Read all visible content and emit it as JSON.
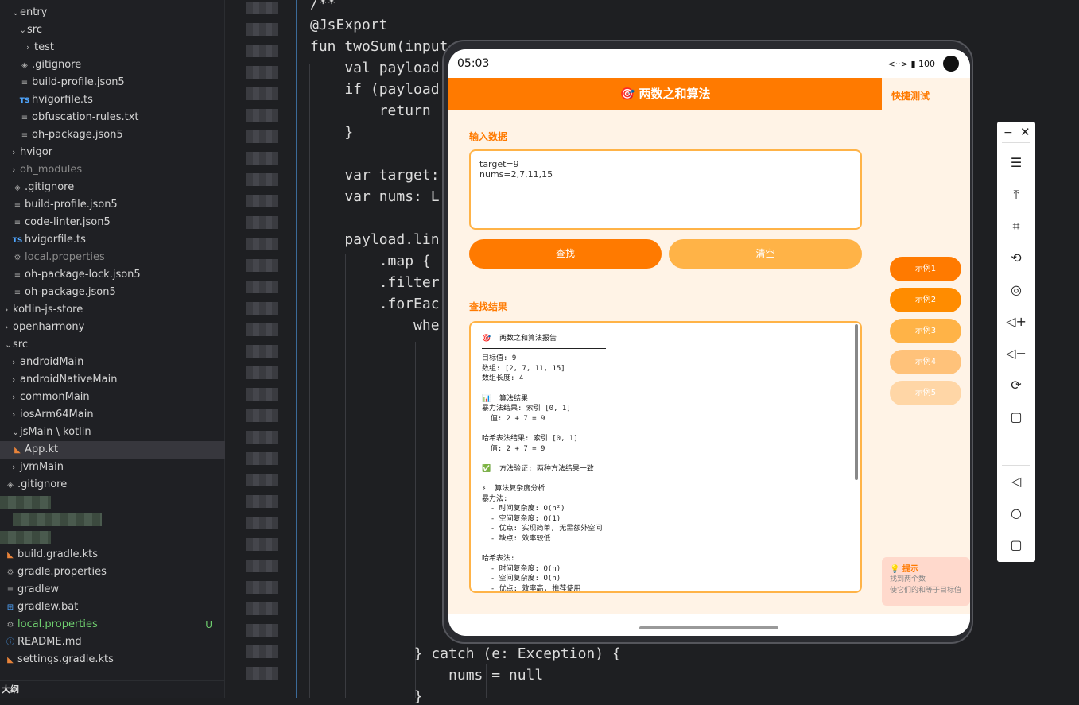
{
  "file_tree": [
    {
      "label": "entry",
      "depth": 1,
      "chevron": "v",
      "icon": ""
    },
    {
      "label": "src",
      "depth": 2,
      "chevron": "v",
      "icon": ""
    },
    {
      "label": "test",
      "depth": 3,
      "chevron": ">",
      "icon": ""
    },
    {
      "label": ".gitignore",
      "depth": 2,
      "chevron": "",
      "icon": "diamond"
    },
    {
      "label": "build-profile.json5",
      "depth": 2,
      "chevron": "",
      "icon": "lines"
    },
    {
      "label": "hvigorfile.ts",
      "depth": 2,
      "chevron": "",
      "icon": "ts"
    },
    {
      "label": "obfuscation-rules.txt",
      "depth": 2,
      "chevron": "",
      "icon": "lines"
    },
    {
      "label": "oh-package.json5",
      "depth": 2,
      "chevron": "",
      "icon": "lines"
    },
    {
      "label": "hvigor",
      "depth": 1,
      "chevron": ">",
      "icon": ""
    },
    {
      "label": "oh_modules",
      "depth": 1,
      "chevron": ">",
      "icon": "",
      "dim": true
    },
    {
      "label": ".gitignore",
      "depth": 1,
      "chevron": "",
      "icon": "diamond"
    },
    {
      "label": "build-profile.json5",
      "depth": 1,
      "chevron": "",
      "icon": "lines"
    },
    {
      "label": "code-linter.json5",
      "depth": 1,
      "chevron": "",
      "icon": "lines"
    },
    {
      "label": "hvigorfile.ts",
      "depth": 1,
      "chevron": "",
      "icon": "ts"
    },
    {
      "label": "local.properties",
      "depth": 1,
      "chevron": "",
      "icon": "gear",
      "dim": true
    },
    {
      "label": "oh-package-lock.json5",
      "depth": 1,
      "chevron": "",
      "icon": "lines"
    },
    {
      "label": "oh-package.json5",
      "depth": 1,
      "chevron": "",
      "icon": "lines"
    },
    {
      "label": "kotlin-js-store",
      "depth": 0,
      "chevron": ">",
      "icon": ""
    },
    {
      "label": "openharmony",
      "depth": 0,
      "chevron": ">",
      "icon": ""
    },
    {
      "label": "src",
      "depth": 0,
      "chevron": "v",
      "icon": ""
    },
    {
      "label": "androidMain",
      "depth": 1,
      "chevron": ">",
      "icon": ""
    },
    {
      "label": "androidNativeMain",
      "depth": 1,
      "chevron": ">",
      "icon": ""
    },
    {
      "label": "commonMain",
      "depth": 1,
      "chevron": ">",
      "icon": ""
    },
    {
      "label": "iosArm64Main",
      "depth": 1,
      "chevron": ">",
      "icon": ""
    },
    {
      "label": "jsMain \\ kotlin",
      "depth": 1,
      "chevron": "v",
      "icon": ""
    },
    {
      "label": "App.kt",
      "depth": 1,
      "chevron": "",
      "icon": "kt",
      "selected": true
    },
    {
      "label": "jvmMain",
      "depth": 1,
      "chevron": ">",
      "icon": ""
    },
    {
      "label": ".gitignore",
      "depth": 0,
      "chevron": "",
      "icon": "diamond"
    },
    {
      "label": "",
      "depth": 0,
      "chevron": "",
      "icon": "",
      "blurred": true
    },
    {
      "label": "",
      "depth": 0,
      "chevron": "",
      "icon": "",
      "blurred": true
    },
    {
      "label": "",
      "depth": 0,
      "chevron": "",
      "icon": "",
      "blurred": true
    },
    {
      "label": "build.gradle.kts",
      "depth": 0,
      "chevron": "",
      "icon": "kt"
    },
    {
      "label": "gradle.properties",
      "depth": 0,
      "chevron": "",
      "icon": "gear"
    },
    {
      "label": "gradlew",
      "depth": 0,
      "chevron": "",
      "icon": "lines"
    },
    {
      "label": "gradlew.bat",
      "depth": 0,
      "chevron": "",
      "icon": "win"
    },
    {
      "label": "local.properties",
      "depth": 0,
      "chevron": "",
      "icon": "gear",
      "green": true,
      "badge": "U"
    },
    {
      "label": "README.md",
      "depth": 0,
      "chevron": "",
      "icon": "info"
    },
    {
      "label": "settings.gradle.kts",
      "depth": 0,
      "chevron": "",
      "icon": "kt"
    }
  ],
  "outline_label": "大纲",
  "code_lines": [
    "/**",
    "@JsExport",
    "fun twoSum(input",
    "    val payload",
    "    if (payload",
    "        return",
    "    }",
    "",
    "    var target:",
    "    var nums: L",
    "",
    "    payload.lin",
    "        .map {",
    "        .filter",
    "        .forEac",
    "            whe"
  ],
  "code_lines_bottom": [
    "        } catch (e: Exception) {",
    "            nums = null",
    "        }"
  ],
  "phone": {
    "status_time": "05:03",
    "status_icons": "<··> ▮ 100",
    "title": "🎯 两数之和算法",
    "input_section_title": "输入数据",
    "input_value": "target=9\nnums=2,7,11,15",
    "find_button": "查找",
    "clear_button": "清空",
    "result_section_title": "查找结果",
    "result_text": "🎯  两数之和算法报告\n\n目标值: 9\n数组: [2, 7, 11, 15]\n数组长度: 4\n\n📊  算法结果\n暴力法结果: 索引 [0, 1]\n  值: 2 + 7 = 9\n\n哈希表法结果: 索引 [0, 1]\n  值: 2 + 7 = 9\n\n✅  方法验证: 两种方法结果一致\n\n⚡  算法复杂度分析\n暴力法:\n  - 时间复杂度: O(n²)\n  - 空间复杂度: O(1)\n  - 优点: 实现简单, 无需额外空间\n  - 缺点: 效率较低\n\n哈希表法:\n  - 时间复杂度: O(n)\n  - 空间复杂度: O(n)\n  - 优点: 效率高, 推荐使用",
    "quick_test_title": "快捷测试",
    "examples": [
      "示例1",
      "示例2",
      "示例3",
      "示例4",
      "示例5"
    ],
    "example_colors": [
      "#ff7a00",
      "#ff8c00",
      "#ffb347",
      "#ffc27a",
      "#ffd6a6"
    ],
    "hint_title": "💡 提示",
    "hint_lines": [
      "找到两个数",
      "使它们的和等于目标值"
    ]
  },
  "toolpanel": {
    "minimize": "−",
    "close": "✕",
    "tools": [
      "menu-icon",
      "move-top-icon",
      "crop-icon",
      "rotate-icon",
      "screenshot-icon",
      "volume-up-icon",
      "volume-down-icon",
      "rotate-screen-icon",
      "square-icon",
      "back-icon",
      "home-icon",
      "recents-icon"
    ],
    "glyphs": [
      "☰",
      "⤒",
      "⌗",
      "⟲",
      "◎",
      "◁+",
      "◁−",
      "⟳",
      "▢",
      "◁",
      "○",
      "▢"
    ]
  },
  "colors": {
    "accent": "#ff7a00",
    "accent_light": "#ffb347",
    "panel_bg": "#fff3e6"
  }
}
